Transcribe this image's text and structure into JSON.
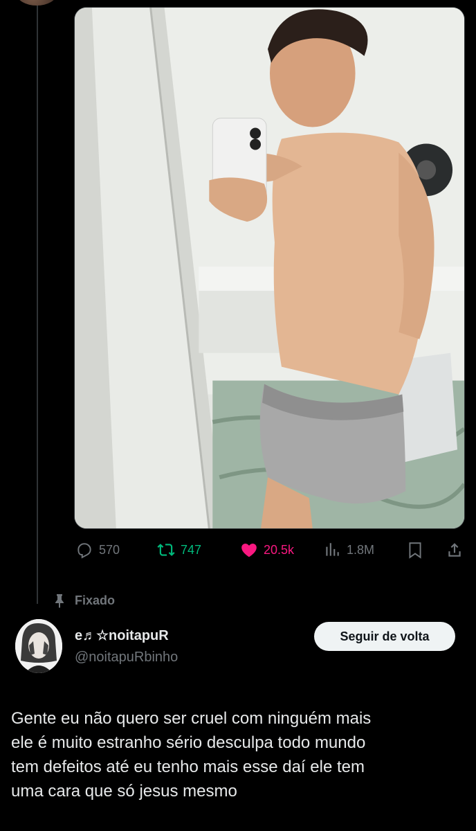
{
  "previous_post": {
    "actions": {
      "replies": "570",
      "reposts": "747",
      "likes": "20.5k",
      "views": "1.8M"
    },
    "colors": {
      "repost": "#00ba7c",
      "like": "#f91880",
      "muted": "#71767b"
    },
    "icons": [
      "reply-icon",
      "repost-icon",
      "like-icon",
      "views-icon",
      "bookmark-icon",
      "share-icon"
    ]
  },
  "pinned_post": {
    "pinned_label": "Fixado",
    "author": {
      "display_name": "e♬☆noitapuR",
      "handle": "@noitapuRbinho"
    },
    "follow_button": "Seguir de volta",
    "text_lines": [
      "Gente eu não quero ser cruel com ninguém mais",
      "ele é muito estranho sério desculpa todo mundo",
      "tem defeitos até eu tenho mais esse daí ele tem",
      "uma cara  que só jesus mesmo"
    ]
  }
}
